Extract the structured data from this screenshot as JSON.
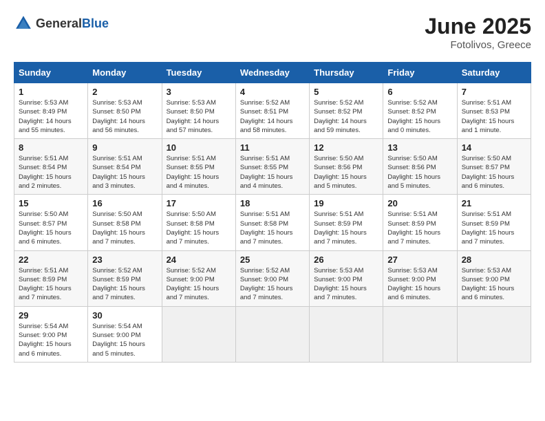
{
  "header": {
    "logo_general": "General",
    "logo_blue": "Blue",
    "month_year": "June 2025",
    "location": "Fotolivos, Greece"
  },
  "days_of_week": [
    "Sunday",
    "Monday",
    "Tuesday",
    "Wednesday",
    "Thursday",
    "Friday",
    "Saturday"
  ],
  "weeks": [
    [
      {
        "day": "1",
        "sunrise": "5:53 AM",
        "sunset": "8:49 PM",
        "daylight": "14 hours and 55 minutes."
      },
      {
        "day": "2",
        "sunrise": "5:53 AM",
        "sunset": "8:50 PM",
        "daylight": "14 hours and 56 minutes."
      },
      {
        "day": "3",
        "sunrise": "5:53 AM",
        "sunset": "8:50 PM",
        "daylight": "14 hours and 57 minutes."
      },
      {
        "day": "4",
        "sunrise": "5:52 AM",
        "sunset": "8:51 PM",
        "daylight": "14 hours and 58 minutes."
      },
      {
        "day": "5",
        "sunrise": "5:52 AM",
        "sunset": "8:52 PM",
        "daylight": "14 hours and 59 minutes."
      },
      {
        "day": "6",
        "sunrise": "5:52 AM",
        "sunset": "8:52 PM",
        "daylight": "15 hours and 0 minutes."
      },
      {
        "day": "7",
        "sunrise": "5:51 AM",
        "sunset": "8:53 PM",
        "daylight": "15 hours and 1 minute."
      }
    ],
    [
      {
        "day": "8",
        "sunrise": "5:51 AM",
        "sunset": "8:54 PM",
        "daylight": "15 hours and 2 minutes."
      },
      {
        "day": "9",
        "sunrise": "5:51 AM",
        "sunset": "8:54 PM",
        "daylight": "15 hours and 3 minutes."
      },
      {
        "day": "10",
        "sunrise": "5:51 AM",
        "sunset": "8:55 PM",
        "daylight": "15 hours and 4 minutes."
      },
      {
        "day": "11",
        "sunrise": "5:51 AM",
        "sunset": "8:55 PM",
        "daylight": "15 hours and 4 minutes."
      },
      {
        "day": "12",
        "sunrise": "5:50 AM",
        "sunset": "8:56 PM",
        "daylight": "15 hours and 5 minutes."
      },
      {
        "day": "13",
        "sunrise": "5:50 AM",
        "sunset": "8:56 PM",
        "daylight": "15 hours and 5 minutes."
      },
      {
        "day": "14",
        "sunrise": "5:50 AM",
        "sunset": "8:57 PM",
        "daylight": "15 hours and 6 minutes."
      }
    ],
    [
      {
        "day": "15",
        "sunrise": "5:50 AM",
        "sunset": "8:57 PM",
        "daylight": "15 hours and 6 minutes."
      },
      {
        "day": "16",
        "sunrise": "5:50 AM",
        "sunset": "8:58 PM",
        "daylight": "15 hours and 7 minutes."
      },
      {
        "day": "17",
        "sunrise": "5:50 AM",
        "sunset": "8:58 PM",
        "daylight": "15 hours and 7 minutes."
      },
      {
        "day": "18",
        "sunrise": "5:51 AM",
        "sunset": "8:58 PM",
        "daylight": "15 hours and 7 minutes."
      },
      {
        "day": "19",
        "sunrise": "5:51 AM",
        "sunset": "8:59 PM",
        "daylight": "15 hours and 7 minutes."
      },
      {
        "day": "20",
        "sunrise": "5:51 AM",
        "sunset": "8:59 PM",
        "daylight": "15 hours and 7 minutes."
      },
      {
        "day": "21",
        "sunrise": "5:51 AM",
        "sunset": "8:59 PM",
        "daylight": "15 hours and 7 minutes."
      }
    ],
    [
      {
        "day": "22",
        "sunrise": "5:51 AM",
        "sunset": "8:59 PM",
        "daylight": "15 hours and 7 minutes."
      },
      {
        "day": "23",
        "sunrise": "5:52 AM",
        "sunset": "8:59 PM",
        "daylight": "15 hours and 7 minutes."
      },
      {
        "day": "24",
        "sunrise": "5:52 AM",
        "sunset": "9:00 PM",
        "daylight": "15 hours and 7 minutes."
      },
      {
        "day": "25",
        "sunrise": "5:52 AM",
        "sunset": "9:00 PM",
        "daylight": "15 hours and 7 minutes."
      },
      {
        "day": "26",
        "sunrise": "5:53 AM",
        "sunset": "9:00 PM",
        "daylight": "15 hours and 7 minutes."
      },
      {
        "day": "27",
        "sunrise": "5:53 AM",
        "sunset": "9:00 PM",
        "daylight": "15 hours and 6 minutes."
      },
      {
        "day": "28",
        "sunrise": "5:53 AM",
        "sunset": "9:00 PM",
        "daylight": "15 hours and 6 minutes."
      }
    ],
    [
      {
        "day": "29",
        "sunrise": "5:54 AM",
        "sunset": "9:00 PM",
        "daylight": "15 hours and 6 minutes."
      },
      {
        "day": "30",
        "sunrise": "5:54 AM",
        "sunset": "9:00 PM",
        "daylight": "15 hours and 5 minutes."
      },
      null,
      null,
      null,
      null,
      null
    ]
  ]
}
